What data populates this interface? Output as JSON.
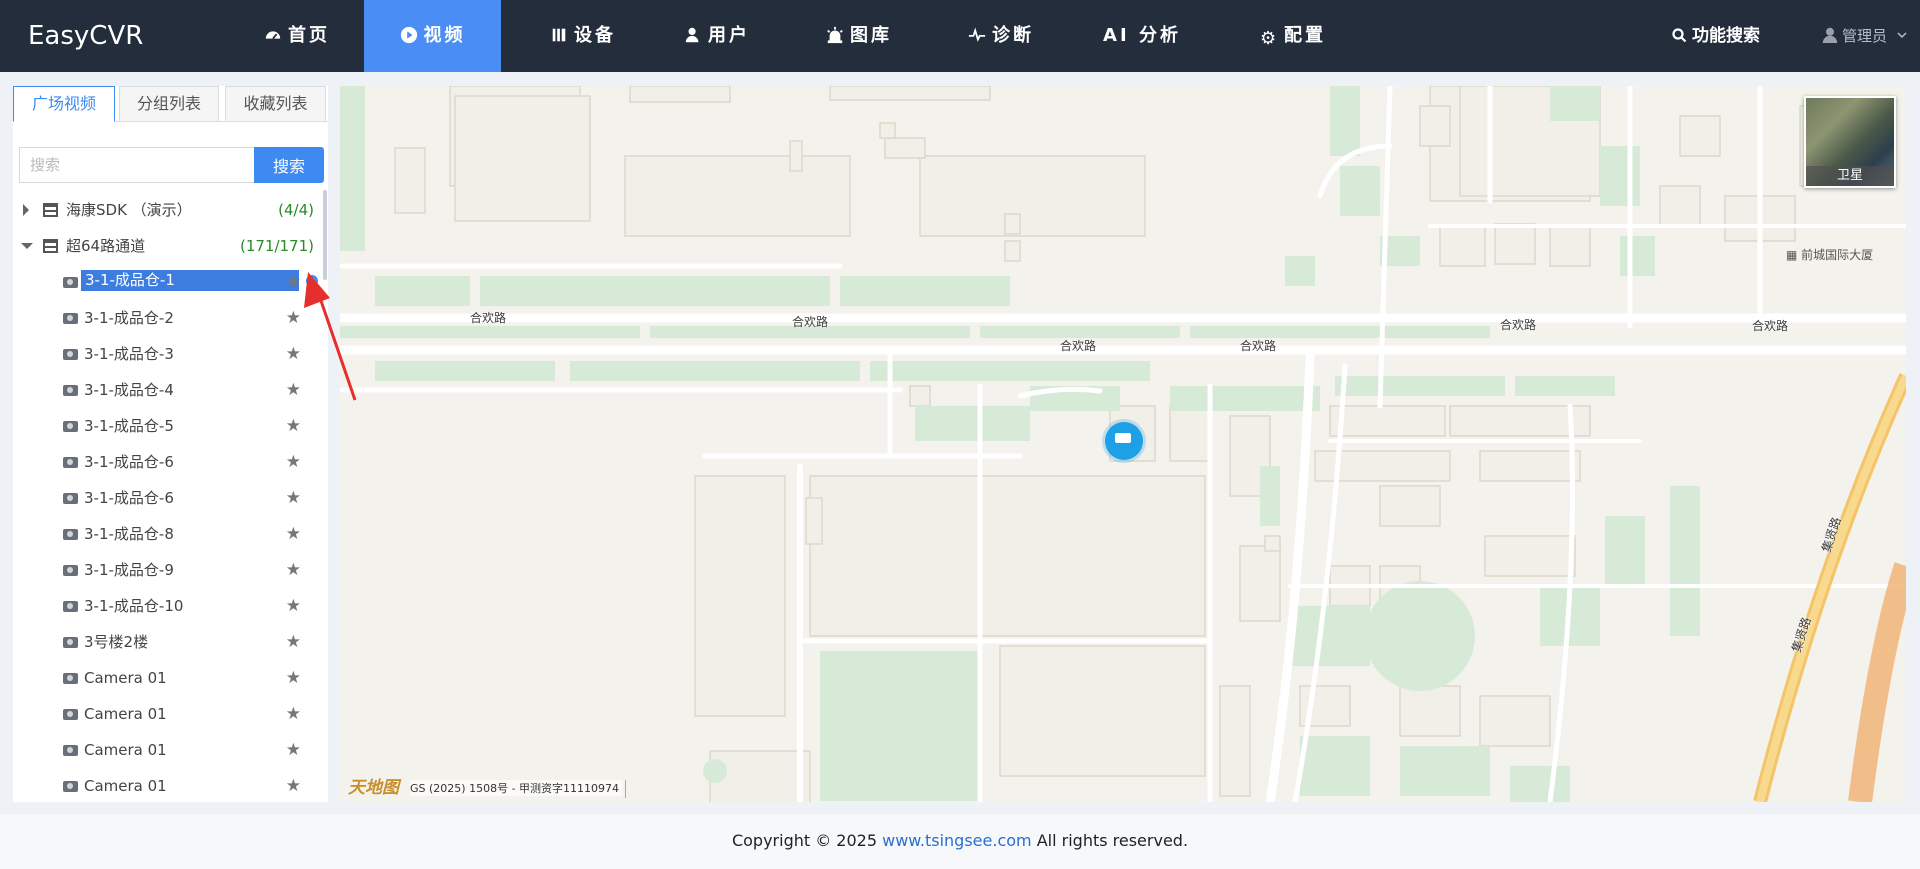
{
  "brand": "EasyCVR",
  "nav": [
    {
      "label": "首页",
      "icon": "dashboard-icon"
    },
    {
      "label": "视频",
      "icon": "play-circle-icon",
      "active": true
    },
    {
      "label": "设备",
      "icon": "device-bars-icon"
    },
    {
      "label": "用户",
      "icon": "user-icon"
    },
    {
      "label": "图库",
      "icon": "alarm-icon"
    },
    {
      "label": "诊断",
      "icon": "pulse-icon"
    },
    {
      "label": "AI 分析",
      "icon": ""
    },
    {
      "label": "配置",
      "icon": "gear-icon"
    }
  ],
  "nav_search": "功能搜索",
  "nav_user": "管理员",
  "sidebar": {
    "tabs": [
      "广场视频",
      "分组列表",
      "收藏列表"
    ],
    "search_placeholder": "搜索",
    "search_button": "搜索",
    "groups": [
      {
        "label": "海康SDK （演示）",
        "count": "(4/4)",
        "expanded": false
      },
      {
        "label": "超64路通道",
        "count": "(171/171)",
        "expanded": true
      }
    ],
    "cameras": [
      "3-1-成品仓-1",
      "3-1-成品仓-2",
      "3-1-成品仓-3",
      "3-1-成品仓-4",
      "3-1-成品仓-5",
      "3-1-成品仓-6",
      "3-1-成品仓-6",
      "3-1-成品仓-8",
      "3-1-成品仓-9",
      "3-1-成品仓-10",
      "3号楼2楼",
      "Camera 01",
      "Camera 01",
      "Camera 01",
      "Camera 01"
    ]
  },
  "map": {
    "road_labels": [
      "合欢路",
      "合欢路",
      "合欢路",
      "合欢路",
      "合欢路",
      "合欢路",
      "集贤路",
      "集贤路"
    ],
    "poi": "前城国际大厦",
    "layer_toggle": "卫星",
    "attribution_logo": "天地图",
    "attribution": "GS (2025) 1508号 - 甲测资字11110974"
  },
  "footer": {
    "prefix": "Copyright © 2025 ",
    "link": "www.tsingsee.com",
    "suffix": " All rights reserved."
  },
  "colors": {
    "nav_bg": "#232d3b",
    "accent": "#4a8df5",
    "selected": "#3d7de0",
    "count": "#2a8a2a"
  }
}
